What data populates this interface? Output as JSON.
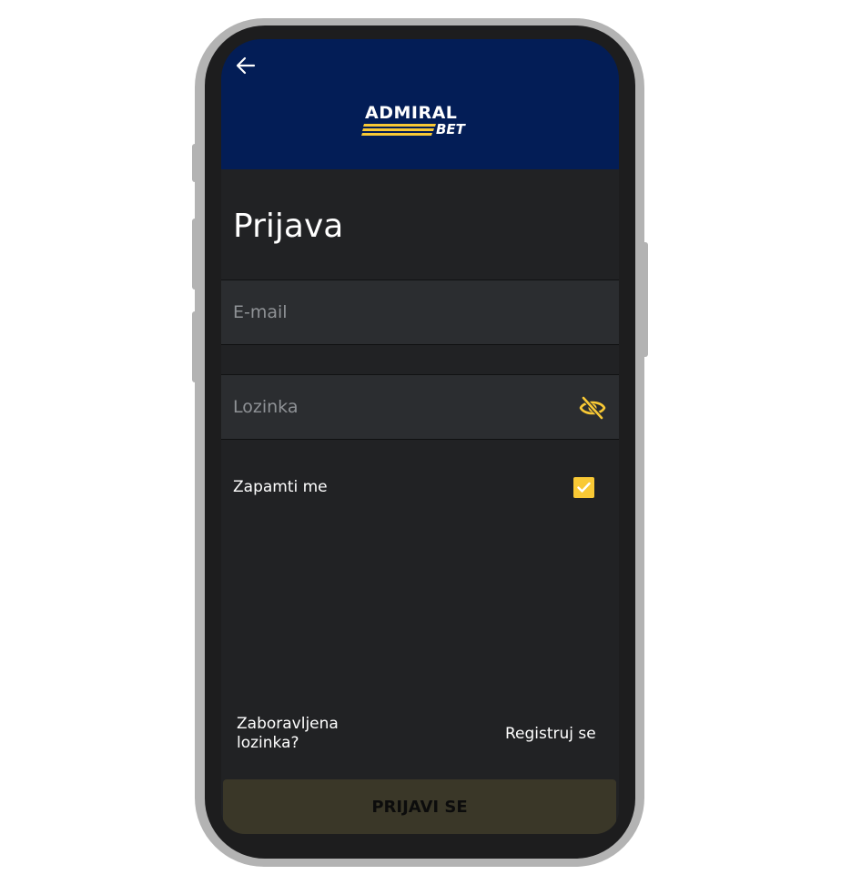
{
  "header": {
    "back_icon": "arrow-left-icon",
    "logo": {
      "line1": "ADMIRAL",
      "line2": "BET"
    }
  },
  "page": {
    "title": "Prijava"
  },
  "form": {
    "email": {
      "placeholder": "E-mail",
      "value": ""
    },
    "password": {
      "placeholder": "Lozinka",
      "value": "",
      "toggle_icon": "eye-off-icon"
    },
    "remember": {
      "label": "Zapamti me",
      "checked": true
    }
  },
  "links": {
    "forgot": "Zaboravljena lozinka?",
    "register": "Registruj se"
  },
  "submit": {
    "label": "PRIJAVI SE"
  },
  "colors": {
    "header_bg": "#031d56",
    "screen_bg": "#212224",
    "field_bg": "#2b2d30",
    "accent": "#f9c935",
    "button_bg": "#3a3728"
  }
}
